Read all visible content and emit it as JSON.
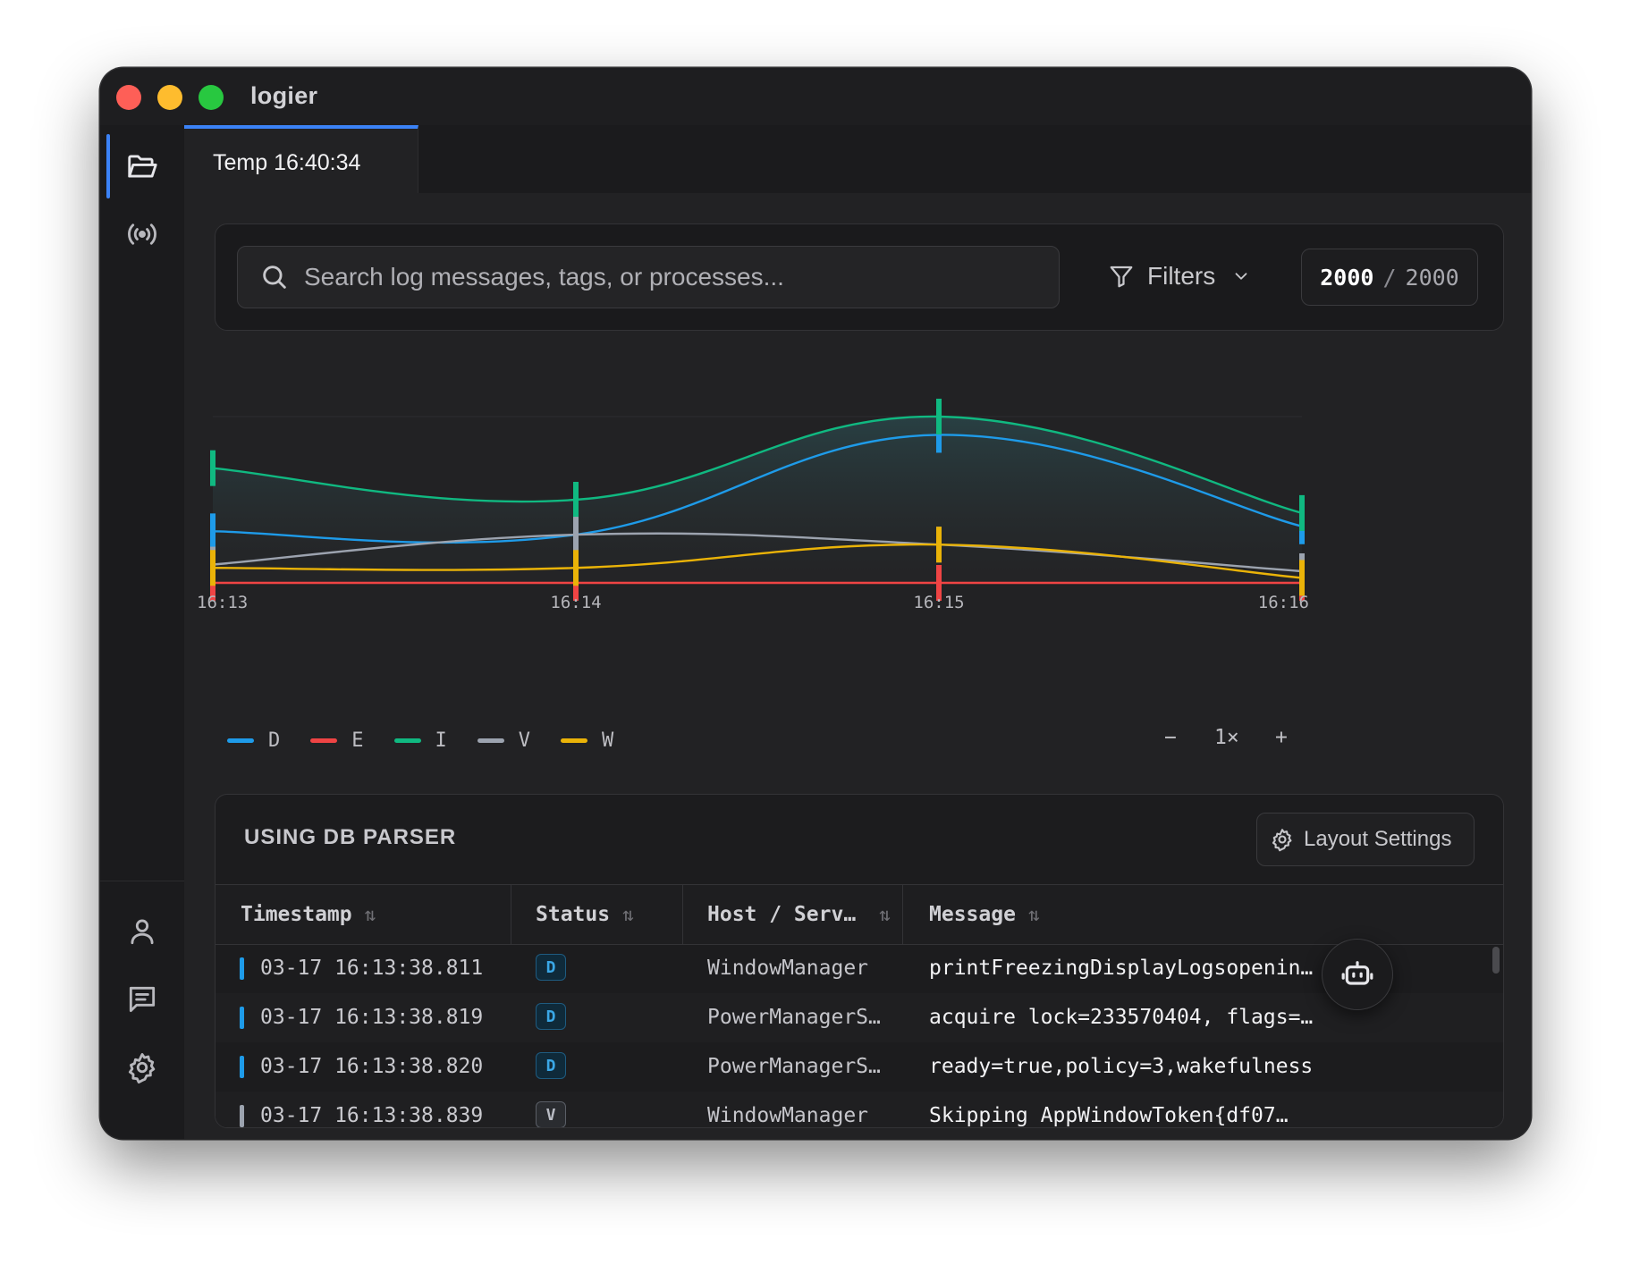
{
  "window": {
    "title": "logier"
  },
  "tabs": [
    {
      "label": "Temp 16:40:34",
      "active": true
    }
  ],
  "sidebar": {
    "top_items": [
      {
        "name": "files",
        "icon": "folder-open-icon",
        "active": true
      },
      {
        "name": "live",
        "icon": "broadcast-icon",
        "active": false
      }
    ],
    "bottom_items": [
      {
        "name": "account",
        "icon": "user-icon"
      },
      {
        "name": "messages",
        "icon": "message-icon"
      },
      {
        "name": "settings",
        "icon": "gear-icon"
      }
    ]
  },
  "search": {
    "placeholder": "Search log messages, tags, or processes...",
    "value": ""
  },
  "filters": {
    "label": "Filters"
  },
  "count": {
    "shown": "2000",
    "separator": "/",
    "total": "2000"
  },
  "chart_data": {
    "type": "area",
    "x": [
      "16:13",
      "16:14",
      "16:15",
      "16:16"
    ],
    "ylim": [
      0,
      100
    ],
    "series": [
      {
        "name": "D",
        "color": "#1e9be9",
        "values": [
          31,
          29,
          89,
          34
        ]
      },
      {
        "name": "E",
        "color": "#ef4444",
        "values": [
          0,
          0,
          0,
          0
        ]
      },
      {
        "name": "I",
        "color": "#10b981",
        "values": [
          69,
          50,
          100,
          42
        ]
      },
      {
        "name": "V",
        "color": "#9ca3af",
        "values": [
          11,
          29,
          23,
          7
        ]
      },
      {
        "name": "W",
        "color": "#eab308",
        "values": [
          9,
          9,
          23,
          3
        ]
      }
    ]
  },
  "zoom": {
    "minus": "−",
    "level": "1×",
    "plus": "+"
  },
  "table": {
    "title": "USING DB PARSER",
    "layout_button": "Layout Settings",
    "columns": [
      {
        "label": "Timestamp"
      },
      {
        "label": "Status"
      },
      {
        "label": "Host / Serv…"
      },
      {
        "label": "Message"
      }
    ],
    "sort_glyph": "⇅",
    "rows": [
      {
        "timestamp": "03-17 16:13:38.811",
        "status": "D",
        "host": "WindowManager",
        "message": "printFreezingDisplayLogsopenin…"
      },
      {
        "timestamp": "03-17 16:13:38.819",
        "status": "D",
        "host": "PowerManagerSe…",
        "message": "acquire lock=233570404, flags=…"
      },
      {
        "timestamp": "03-17 16:13:38.820",
        "status": "D",
        "host": "PowerManagerSe…",
        "message": "ready=true,policy=3,wakefulness"
      },
      {
        "timestamp": "03-17 16:13:38.839",
        "status": "V",
        "host": "WindowManager",
        "message": "Skipping AppWindowToken{df07…"
      }
    ]
  },
  "colors": {
    "accent": "#3b82f6",
    "D": "#1e9be9",
    "V": "#9ca3af"
  },
  "fab": {
    "icon": "bot-icon"
  }
}
